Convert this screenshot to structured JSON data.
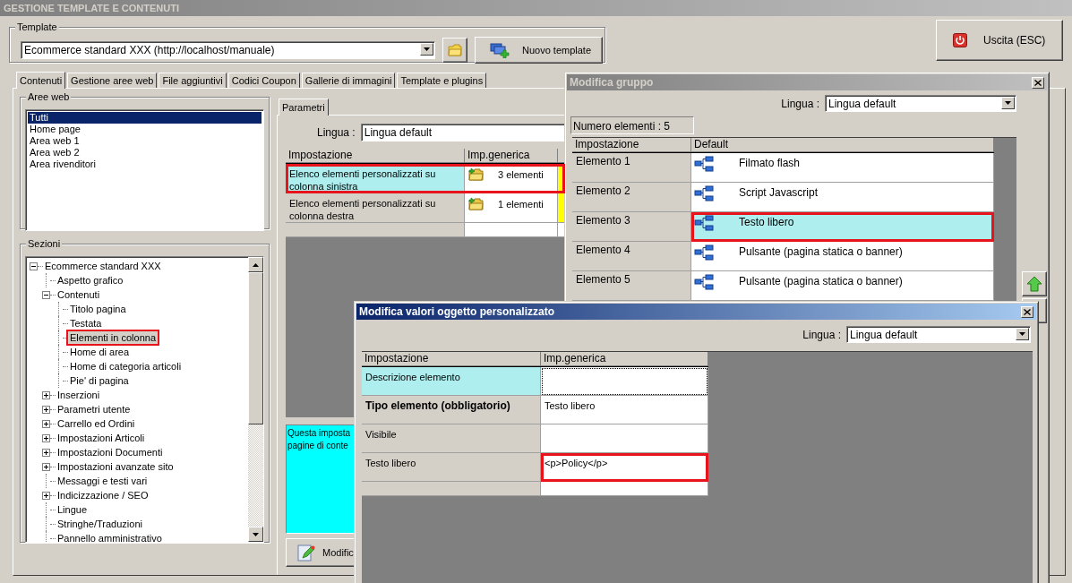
{
  "window": {
    "title": "GESTIONE TEMPLATE E CONTENUTI",
    "exit_button": "Uscita (ESC)"
  },
  "template": {
    "legend": "Template",
    "value": "Ecommerce standard XXX (http://localhost/manuale)",
    "new_button": "Nuovo template"
  },
  "tabs": [
    {
      "label": "Contenuti",
      "selected": true
    },
    {
      "label": "Gestione aree web",
      "selected": false
    },
    {
      "label": "File aggiuntivi",
      "selected": false
    },
    {
      "label": "Codici Coupon",
      "selected": false
    },
    {
      "label": "Gallerie di immagini",
      "selected": false
    },
    {
      "label": "Template e plugins",
      "selected": false
    }
  ],
  "web_areas": {
    "legend": "Aree web",
    "items": [
      {
        "label": "Tutti",
        "selected": true
      },
      {
        "label": "Home page",
        "selected": false
      },
      {
        "label": "Area web 1",
        "selected": false
      },
      {
        "label": "Area web 2",
        "selected": false
      },
      {
        "label": "Area rivenditori",
        "selected": false
      }
    ]
  },
  "sections": {
    "legend": "Sezioni",
    "tree": [
      {
        "label": "Ecommerce standard XXX",
        "expanded": true,
        "selected": false,
        "highlighted": false,
        "children": [
          {
            "label": "Aspetto grafico",
            "selected": false,
            "highlighted": false
          },
          {
            "label": "Contenuti",
            "expanded": true,
            "selected": false,
            "highlighted": false,
            "children": [
              {
                "label": "Titolo pagina",
                "selected": false,
                "highlighted": false
              },
              {
                "label": "Testata",
                "selected": false,
                "highlighted": false
              },
              {
                "label": "Elementi in colonna",
                "selected": true,
                "highlighted": true
              },
              {
                "label": "Home di area",
                "selected": false,
                "highlighted": false
              },
              {
                "label": "Home di categoria articoli",
                "selected": false,
                "highlighted": false
              },
              {
                "label": "Pie' di pagina",
                "selected": false,
                "highlighted": false
              }
            ]
          },
          {
            "label": "Inserzioni",
            "expanded": false,
            "selected": false,
            "highlighted": false
          },
          {
            "label": "Parametri utente",
            "expanded": false,
            "selected": false,
            "highlighted": false
          },
          {
            "label": "Carrello ed Ordini",
            "expanded": false,
            "selected": false,
            "highlighted": false
          },
          {
            "label": "Impostazioni Articoli",
            "expanded": false,
            "selected": false,
            "highlighted": false
          },
          {
            "label": "Impostazioni Documenti",
            "expanded": false,
            "selected": false,
            "highlighted": false
          },
          {
            "label": "Impostazioni avanzate sito",
            "expanded": false,
            "selected": false,
            "highlighted": false
          },
          {
            "label": "Messaggi e testi vari",
            "selected": false,
            "highlighted": false
          },
          {
            "label": "Indicizzazione / SEO",
            "expanded": false,
            "selected": false,
            "highlighted": false
          },
          {
            "label": "Lingue",
            "selected": false,
            "highlighted": false
          },
          {
            "label": "Stringhe/Traduzioni",
            "selected": false,
            "highlighted": false
          },
          {
            "label": "Pannello amministrativo",
            "selected": false,
            "highlighted": false
          }
        ]
      }
    ]
  },
  "params": {
    "tab": "Parametri",
    "language_label": "Lingua :",
    "language": "Lingua default",
    "columns": [
      "Impostazione",
      "Imp.generica"
    ],
    "rows": [
      {
        "setting": "Elenco elementi personalizzati su colonna sinistra",
        "value": "3 elementi",
        "selected": true,
        "highlighted": true
      },
      {
        "setting": "Elenco elementi personalizzati su colonna destra",
        "value": "1 elementi",
        "selected": false,
        "highlighted": false
      }
    ],
    "description": [
      "Questa imposta",
      "pagine di conte"
    ],
    "edit_button": "Modific"
  },
  "group_dialog": {
    "title": "Modifica gruppo",
    "language_label": "Lingua :",
    "language": "Lingua default",
    "count": "Numero elementi : 5",
    "columns": [
      "Impostazione",
      "Default"
    ],
    "rows": [
      {
        "setting": "Elemento 1",
        "value": "Filmato flash",
        "selected": false,
        "highlighted": false
      },
      {
        "setting": "Elemento 2",
        "value": "Script Javascript",
        "selected": false,
        "highlighted": false
      },
      {
        "setting": "Elemento 3",
        "value": "Testo libero",
        "selected": true,
        "highlighted": true
      },
      {
        "setting": "Elemento 4",
        "value": "Pulsante (pagina statica o banner)",
        "selected": false,
        "highlighted": false
      },
      {
        "setting": "Elemento 5",
        "value": "Pulsante (pagina statica o banner)",
        "selected": false,
        "highlighted": false
      }
    ]
  },
  "edit_dialog": {
    "title": "Modifica valori oggetto personalizzato",
    "language_label": "Lingua :",
    "language": "Lingua default",
    "columns": [
      "Impostazione",
      "Imp.generica"
    ],
    "rows": [
      {
        "setting": "Descrizione elemento",
        "required": false,
        "selected": true,
        "highlighted": false
      },
      {
        "setting": "Tipo elemento (obbligatorio)",
        "value": "Testo libero",
        "required": true,
        "selected": false,
        "highlighted": false
      },
      {
        "setting": "Visibile",
        "required": false,
        "selected": false,
        "highlighted": false
      },
      {
        "setting": "Testo libero",
        "value": "<p>Policy</p>",
        "required": false,
        "selected": false,
        "highlighted": true
      }
    ]
  }
}
